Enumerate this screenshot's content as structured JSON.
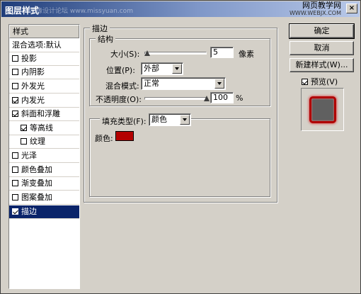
{
  "dialog": {
    "title": "图层样式",
    "watermark": "思缘设计论坛 www.missyuan.com",
    "brand_name": "网页教学网",
    "brand_url": "WWW.WEBJX.COM",
    "close_glyph": "×"
  },
  "style_list": {
    "header": "样式",
    "blend_options": "混合选项:默认",
    "items": [
      {
        "label": "投影",
        "checked": false
      },
      {
        "label": "内阴影",
        "checked": false
      },
      {
        "label": "外发光",
        "checked": false
      },
      {
        "label": "内发光",
        "checked": true
      },
      {
        "label": "斜面和浮雕",
        "checked": true
      },
      {
        "label": "等高线",
        "checked": true
      },
      {
        "label": "纹理",
        "checked": false
      },
      {
        "label": "光泽",
        "checked": false
      },
      {
        "label": "颜色叠加",
        "checked": false
      },
      {
        "label": "渐变叠加",
        "checked": false
      },
      {
        "label": "图案叠加",
        "checked": false
      },
      {
        "label": "描边",
        "checked": true
      }
    ]
  },
  "stroke": {
    "section_title": "描边",
    "structure_title": "结构",
    "size_label": "大小(S):",
    "size_value": "5",
    "size_unit": "像素",
    "size_level": 0.05,
    "position_label": "位置(P):",
    "position_value": "外部",
    "blend_label": "混合模式:",
    "blend_value": "正常",
    "opacity_label": "不透明度(O):",
    "opacity_value": "100",
    "opacity_unit": "%",
    "opacity_level": 1.0,
    "fill_type_label": "填充类型(F):",
    "fill_type_value": "颜色",
    "color_label": "颜色:",
    "color_value": "#b40000"
  },
  "buttons": {
    "ok": "确定",
    "cancel": "取消",
    "new_style": "新建样式(W)...",
    "preview_label": "预览(V)",
    "preview_checked": true
  }
}
